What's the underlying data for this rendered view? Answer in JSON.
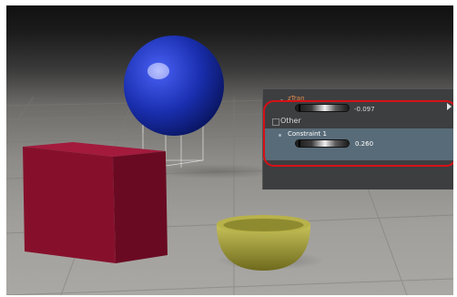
{
  "params": {
    "ztran": {
      "label": "zTran",
      "value": "-0.097"
    },
    "group_label": "Other",
    "constraint": {
      "label": "Constraint 1",
      "value": "0.260"
    }
  },
  "colors": {
    "param_label": "#e38a4a",
    "highlight": "#d71016",
    "group_bar": "#586b78",
    "panel": "#3d3e40",
    "sphere": "#1a2fb0",
    "cube": "#8b0f2e",
    "bowl": "#a8a23a"
  },
  "icons": [
    "expand-arrow-icon",
    "collapse-checkbox-icon",
    "dial-slider-icon"
  ]
}
